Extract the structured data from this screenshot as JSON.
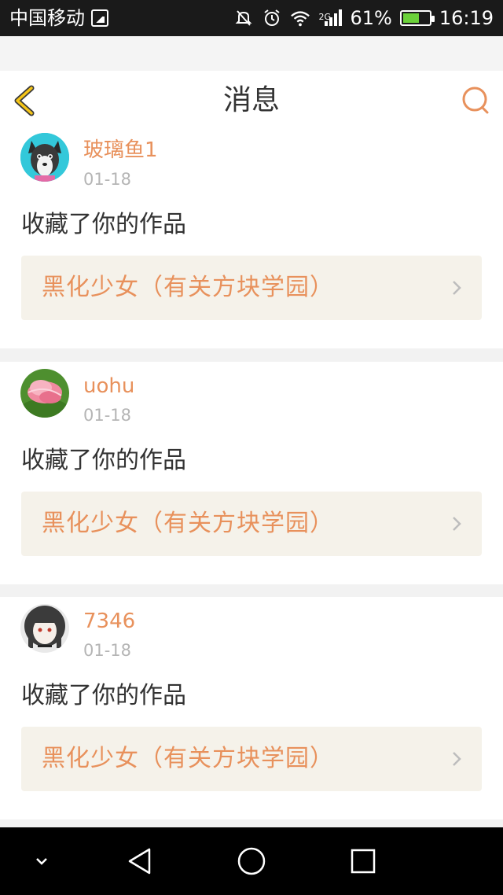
{
  "status_bar": {
    "carrier": "中国移动",
    "network": "2G",
    "battery": "61%",
    "battery_level": 0.61,
    "time": "16:19",
    "icons": [
      "gallery-icon",
      "mute-icon",
      "alarm-icon",
      "wifi-icon",
      "signal-icon",
      "battery-icon"
    ]
  },
  "header": {
    "title": "消息",
    "back_icon": "chevron-left-icon",
    "search_icon": "search-icon"
  },
  "messages": [
    {
      "user": "玻璃鱼1",
      "date": "01-18",
      "action": "收藏了你的作品",
      "work": "黑化少女（有关方块学园）",
      "avatar": "husky-avatar"
    },
    {
      "user": "uohu",
      "date": "01-18",
      "action": "收藏了你的作品",
      "work": "黑化少女（有关方块学园）",
      "avatar": "lotus-avatar"
    },
    {
      "user": "7346",
      "date": "01-18",
      "action": "收藏了你的作品",
      "work": "黑化少女（有关方块学园）",
      "avatar": "anime-girl-avatar"
    }
  ],
  "nav_bar": {
    "icons": [
      "hide-keyboard-icon",
      "back-triangle-icon",
      "home-circle-icon",
      "recents-square-icon"
    ]
  },
  "colors": {
    "accent": "#e8915c",
    "header_back": "#f5c518",
    "work_box_bg": "#f5f2ea",
    "text": "#333333",
    "muted": "#b5b5b5"
  }
}
